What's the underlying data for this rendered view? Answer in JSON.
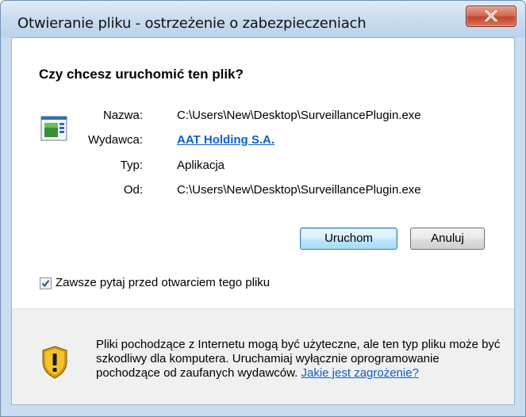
{
  "window": {
    "title": "Otwieranie pliku - ostrzeżenie o zabezpieczeniach"
  },
  "dialog": {
    "heading": "Czy chcesz uruchomić ten plik?",
    "fields": [
      {
        "label": "Nazwa:",
        "value": "C:\\Users\\New\\Desktop\\SurveillancePlugin.exe"
      },
      {
        "label": "Wydawca:",
        "value": "AAT Holding  S.A."
      },
      {
        "label": "Typ:",
        "value": "Aplikacja"
      },
      {
        "label": "Od:",
        "value": "C:\\Users\\New\\Desktop\\SurveillancePlugin.exe"
      }
    ],
    "buttons": {
      "run": "Uruchom",
      "cancel": "Anuluj"
    },
    "checkbox": {
      "label": "Zawsze pytaj przed otwarciem tego pliku",
      "checked": true
    },
    "warning": {
      "text": "Pliki pochodzące z Internetu mogą być użyteczne, ale ten typ pliku może być szkodliwy dla komputera. Uruchamiaj wyłącznie oprogramowanie pochodzące od zaufanych wydawców.",
      "link": "Jakie jest zagrożenie?"
    }
  },
  "icons": {
    "close": "close-icon",
    "file": "application-file-icon",
    "shield": "warning-shield-icon"
  },
  "colors": {
    "link": "#0b5fce",
    "close_button": "#c4442c",
    "frame": "#c9dcf0"
  }
}
